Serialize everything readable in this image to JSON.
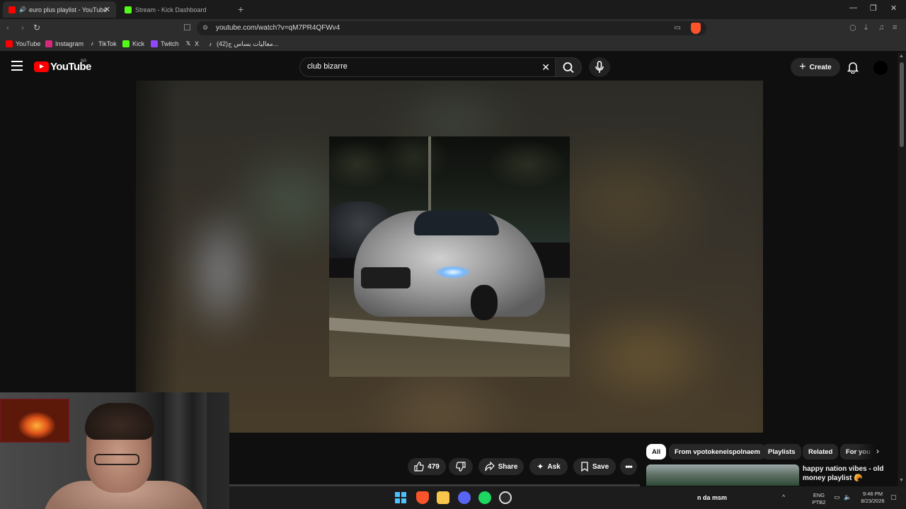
{
  "browser": {
    "tabs": [
      {
        "title": "euro plus playlist - YouTube",
        "active": true
      },
      {
        "title": "Stream - Kick Dashboard",
        "active": false
      }
    ],
    "url": "youtube.com/watch?v=qM7PR4QFWv4",
    "bookmarks": [
      "YouTube",
      "Instagram",
      "TikTok",
      "Kick",
      "Twitch",
      "X",
      "(42)معالیات بساس ج..."
    ]
  },
  "header": {
    "logo_text": "YouTube",
    "country_code": "BR",
    "search_value": "club bizarre",
    "create_label": "Create"
  },
  "actions": {
    "like_count": "479",
    "share_label": "Share",
    "ask_label": "Ask",
    "save_label": "Save"
  },
  "chips": [
    "All",
    "From vpotokeneispolnaem",
    "Playlists",
    "Related",
    "For you"
  ],
  "recommendation": {
    "title": "happy nation vibes - old money playlist 🥐"
  },
  "webcam": {
    "caption": "n da msm"
  },
  "taskbar": {
    "lang_top": "ENG",
    "lang_bottom": "PTB2",
    "time": "9:46 PM",
    "date": "8/23/2026"
  },
  "colors": {
    "yt_red": "#ff0000",
    "brave_orange": "#fb542b",
    "kick_green": "#53fc18",
    "background": "#0f0f0f"
  }
}
